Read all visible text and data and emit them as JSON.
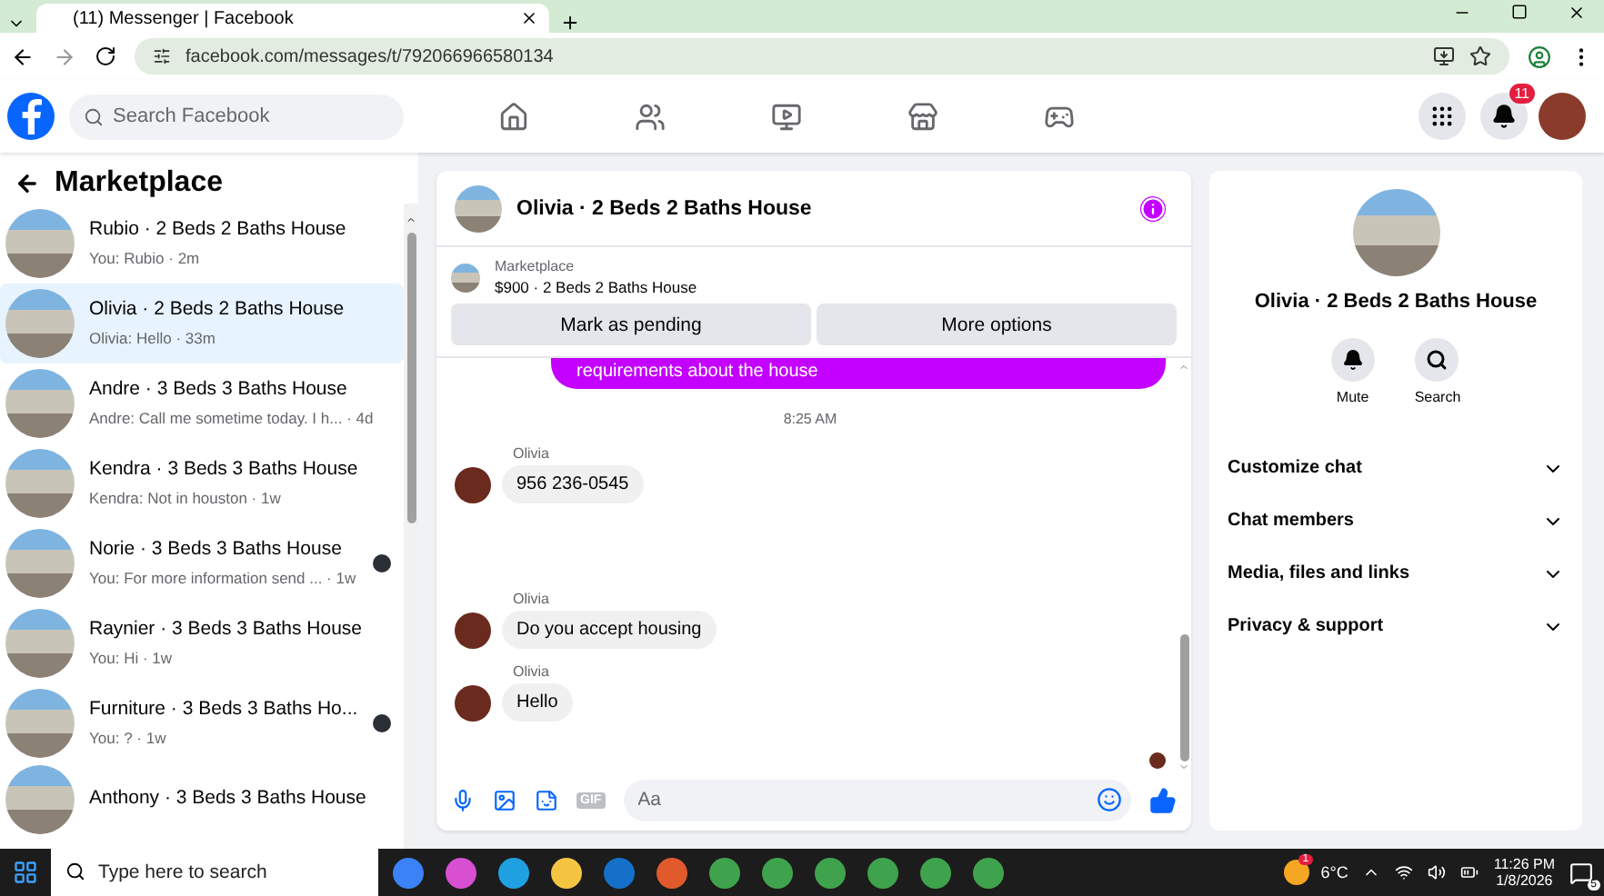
{
  "browser": {
    "tab_title": "(11) Messenger | Facebook",
    "url": "facebook.com/messages/t/792066966580134"
  },
  "header": {
    "search_placeholder": "Search Facebook",
    "notification_count": "11"
  },
  "sidebar": {
    "title": "Marketplace",
    "items": [
      {
        "title": "Rubio · 2 Beds 2 Baths House",
        "preview": "You: Rubio · 2m",
        "selected": false,
        "seen": false
      },
      {
        "title": "Olivia · 2 Beds 2 Baths House",
        "preview": "Olivia: Hello · 33m",
        "selected": true,
        "seen": false
      },
      {
        "title": "Andre · 3 Beds 3 Baths House",
        "preview": "Andre: Call me sometime today. I h... · 4d",
        "selected": false,
        "seen": false
      },
      {
        "title": "Kendra · 3 Beds 3 Baths House",
        "preview": "Kendra: Not in houston · 1w",
        "selected": false,
        "seen": false
      },
      {
        "title": "Norie · 3 Beds 3 Baths House",
        "preview": "You: For more information send ... · 1w",
        "selected": false,
        "seen": true
      },
      {
        "title": "Raynier · 3 Beds 3 Baths House",
        "preview": "You: Hi · 1w",
        "selected": false,
        "seen": false
      },
      {
        "title": "Furniture · 3 Beds 3 Baths Ho...",
        "preview": "You: ? · 1w",
        "selected": false,
        "seen": true
      },
      {
        "title": "Anthony · 3 Beds 3 Baths House",
        "selected": false,
        "seen": false
      }
    ]
  },
  "chat": {
    "title": "Olivia · 2 Beds 2 Baths House",
    "listing": {
      "label": "Marketplace",
      "text": "$900 · 2 Beds 2 Baths House"
    },
    "buttons": [
      "Mark as pending",
      "More options"
    ],
    "messages": [
      {
        "kind": "outgoing",
        "text": "requirements about the house"
      },
      {
        "kind": "time",
        "text": "8:25 AM"
      },
      {
        "kind": "incoming",
        "sender": "Olivia",
        "text": "956 236-0545"
      },
      {
        "kind": "incoming",
        "sender": "Olivia",
        "text": "Do you accept housing"
      },
      {
        "kind": "incoming",
        "sender": "Olivia",
        "text": "Hello"
      }
    ],
    "gif_label": "GIF",
    "composer_placeholder": "Aa"
  },
  "details": {
    "title": "Olivia · 2 Beds 2 Baths House",
    "actions": [
      {
        "kind": "mute",
        "label": "Mute"
      },
      {
        "kind": "search",
        "label": "Search"
      }
    ],
    "sections": [
      {
        "label": "Customize chat",
        "expanded": false
      },
      {
        "label": "Chat members",
        "expanded": false
      },
      {
        "label": "Media, files and links",
        "expanded": false
      },
      {
        "label": "Privacy & support",
        "expanded": false
      }
    ]
  },
  "taskbar": {
    "search_placeholder": "Type here to search",
    "weather_badge": "1",
    "temperature": "6°C",
    "time": "11:26 PM",
    "date": "1/8/2026",
    "notification_count": "5"
  }
}
